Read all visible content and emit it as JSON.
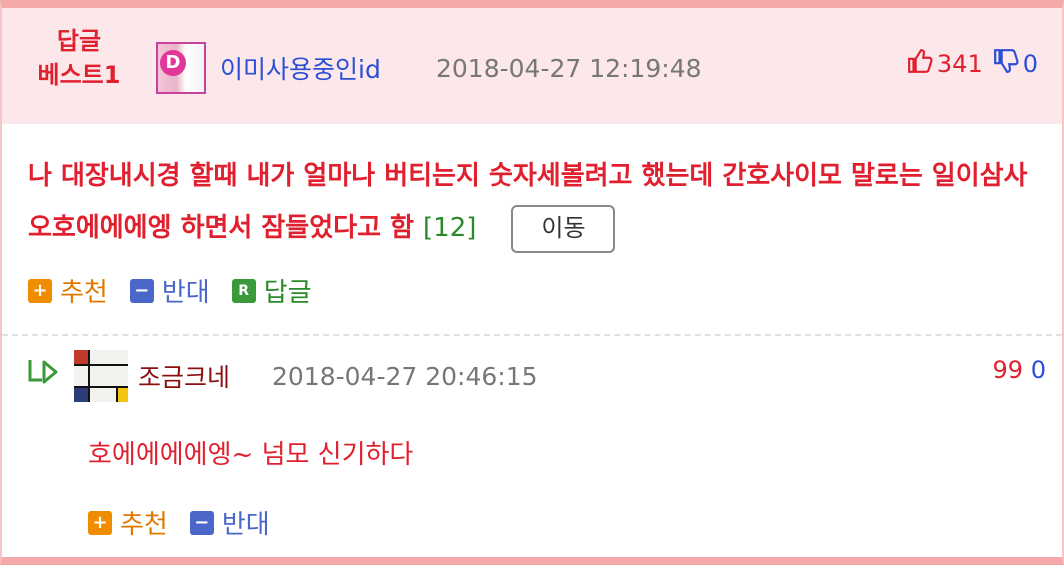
{
  "best_comment": {
    "badge_line1": "답글",
    "badge_line2": "베스트1",
    "avatar_letter": "D",
    "author": "이미사용중인id",
    "timestamp": "2018-04-27 12:19:48",
    "upvotes": "341",
    "downvotes": "0",
    "text": "나 대장내시경 할때 내가 얼마나 버티는지 숫자세볼려고 했는데 간호사이모 말로는 일이삼사오호에에에엥 하면서 잠들었다고 함",
    "reply_count": "[12]",
    "move_button": "이동",
    "actions": {
      "recommend": "추천",
      "oppose": "반대",
      "reply": "답글",
      "reply_icon": "R"
    }
  },
  "reply": {
    "author": "조금크네",
    "timestamp": "2018-04-27 20:46:15",
    "upvotes": "99",
    "downvotes": "0",
    "text": "호에에에에엥~ 넘모 신기하다",
    "actions": {
      "recommend": "추천",
      "oppose": "반대"
    }
  },
  "colors": {
    "accent_red": "#e0202f",
    "author_blue": "#2a4fd6",
    "header_bg": "#fce8ea",
    "frame_pink": "#f6a9a9"
  },
  "icons": [
    "thumbs-up-icon",
    "thumbs-down-icon",
    "plus-icon",
    "minus-icon",
    "reply-icon",
    "reply-arrow-icon"
  ]
}
